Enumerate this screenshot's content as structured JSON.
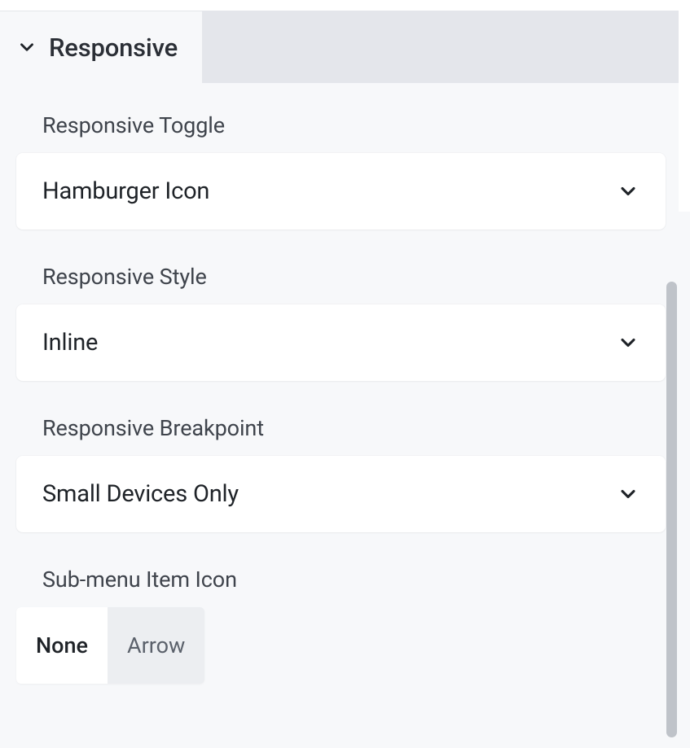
{
  "tab": {
    "title": "Responsive"
  },
  "fields": {
    "responsive_toggle": {
      "label": "Responsive Toggle",
      "value": "Hamburger Icon"
    },
    "responsive_style": {
      "label": "Responsive Style",
      "value": "Inline"
    },
    "responsive_breakpoint": {
      "label": "Responsive Breakpoint",
      "value": "Small Devices Only"
    },
    "submenu_icon": {
      "label": "Sub-menu Item Icon",
      "options": [
        "None",
        "Arrow"
      ],
      "selected": "None"
    }
  }
}
